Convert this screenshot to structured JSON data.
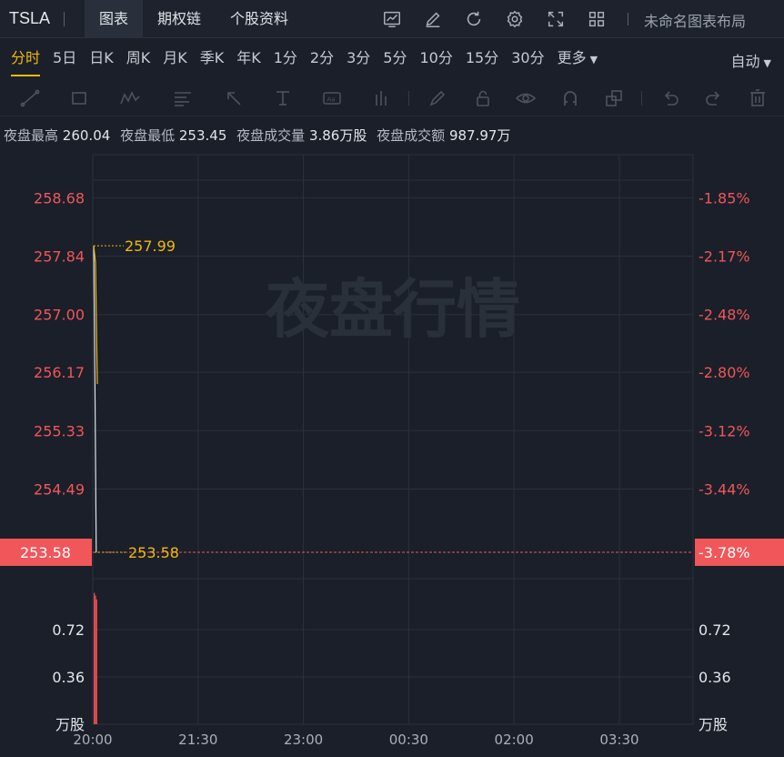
{
  "header": {
    "symbol": "TSLA",
    "tabs": [
      {
        "label": "图表",
        "active": true
      },
      {
        "label": "期权链",
        "active": false
      },
      {
        "label": "个股资料",
        "active": false
      }
    ],
    "icons": [
      "chart-indicator-icon",
      "edit-pen-icon",
      "refresh-icon",
      "settings-gear-icon",
      "fullscreen-icon",
      "grid-layout-icon"
    ],
    "layout_name": "未命名图表布局"
  },
  "periods": {
    "items": [
      "分时",
      "5日",
      "日K",
      "周K",
      "月K",
      "季K",
      "年K",
      "1分",
      "2分",
      "3分",
      "5分",
      "10分",
      "15分",
      "30分",
      "更多"
    ],
    "active_index": 0,
    "auto_label": "自动"
  },
  "drawing_tools": [
    "trend-line-icon",
    "rectangle-icon",
    "wave-pattern-icon",
    "fibonacci-icon",
    "arrow-icon",
    "text-tool-icon",
    "annotation-icon",
    "price-range-icon",
    "brush-icon",
    "lock-icon",
    "eye-visibility-icon",
    "magnet-icon",
    "layers-icon",
    "undo-icon",
    "redo-icon",
    "trash-icon"
  ],
  "stats": {
    "high_label": "夜盘最高",
    "high_value": "260.04",
    "low_label": "夜盘最低",
    "low_value": "253.45",
    "volume_label": "夜盘成交量",
    "volume_value": "3.86万股",
    "turnover_label": "夜盘成交额",
    "turnover_value": "987.97万"
  },
  "watermark": "夜盘行情",
  "colors": {
    "up_red": "#f0565a",
    "price_line": "#f0b90b",
    "avg_line": "#dfe3ea",
    "grid": "#2b313b",
    "volume": "#e84c50"
  },
  "chart_data": {
    "type": "line",
    "x_ticks": [
      "20:00",
      "21:30",
      "23:00",
      "00:30",
      "02:00",
      "03:30"
    ],
    "price_ticks": [
      258.68,
      257.84,
      257.0,
      256.17,
      255.33,
      254.49
    ],
    "pct_ticks": [
      "-1.85%",
      "-2.17%",
      "-2.48%",
      "-2.80%",
      "-3.12%",
      "-3.44%"
    ],
    "ylim": [
      253.2,
      259.3
    ],
    "series": [
      {
        "values": [
          257.99,
          257.75,
          256.0
        ]
      },
      {
        "values": [
          257.99,
          256.0,
          253.58
        ]
      }
    ],
    "current_price": "253.58",
    "current_pct": "-3.78%",
    "annotations": [
      {
        "label": "257.99",
        "value": 257.99
      },
      {
        "label": "253.58",
        "value": 253.58
      }
    ],
    "volume": {
      "unit": "万股",
      "ticks": [
        "0.72",
        "0.36"
      ],
      "tick_values": [
        0.72,
        0.36
      ],
      "ylim": [
        0,
        1.08
      ],
      "values": [
        1.0,
        0.98,
        0.95
      ]
    }
  }
}
